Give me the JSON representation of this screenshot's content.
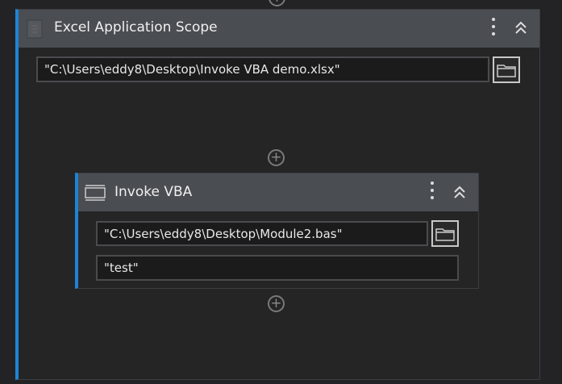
{
  "scope": {
    "title": "Excel Application Scope",
    "workbook_path": "\"C:\\Users\\eddy8\\Desktop\\Invoke VBA  demo.xlsx\""
  },
  "invoke_vba": {
    "title": "Invoke VBA",
    "code_file_path": "\"C:\\Users\\eddy8\\Desktop\\Module2.bas\"",
    "entry_method": "\"test\""
  },
  "colors": {
    "accent": "#1d84d6",
    "header": "#4a4d52"
  }
}
